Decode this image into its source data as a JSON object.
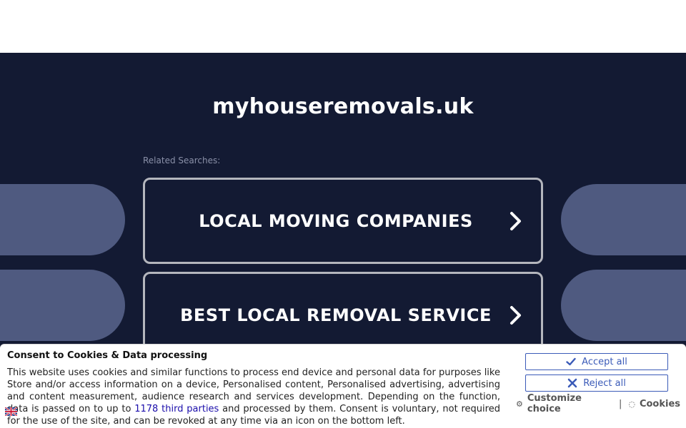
{
  "page": {
    "domain_title": "myhouseremovals.uk",
    "related_label": "Related Searches:"
  },
  "searches": [
    {
      "label": "LOCAL MOVING COMPANIES"
    },
    {
      "label": "BEST LOCAL REMOVAL SERVICE"
    }
  ],
  "consent": {
    "title": "Consent to Cookies & Data processing",
    "text_before_link": "This website uses cookies and similar functions to process end device and personal data for purposes like Store and/or access information on a device, Personalised content, Personalised advertising, advertising and content measurement, audience research and services development. Depending on the function, data is passed on to up to ",
    "link_text": "1178 third parties",
    "text_after_link": " and processed by them. Consent is voluntary, not required for the use of the site, and can be revoked at any time via an icon on the bottom left.",
    "accept_label": "Accept all",
    "reject_label": "Reject all",
    "customize_label": "Customize choice",
    "separator": "|",
    "cookies_label": "Cookies"
  },
  "colors": {
    "background": "#131a33",
    "blob": "#4f5a80",
    "button_border": "#b4b6bd",
    "consent_accent": "#3b5bb8"
  },
  "icons": {
    "chevron": "chevron-right-icon",
    "accept": "check-icon",
    "reject": "close-icon",
    "customize": "gear-icon",
    "cookies": "cookie-icon",
    "flag": "uk-flag-icon"
  }
}
